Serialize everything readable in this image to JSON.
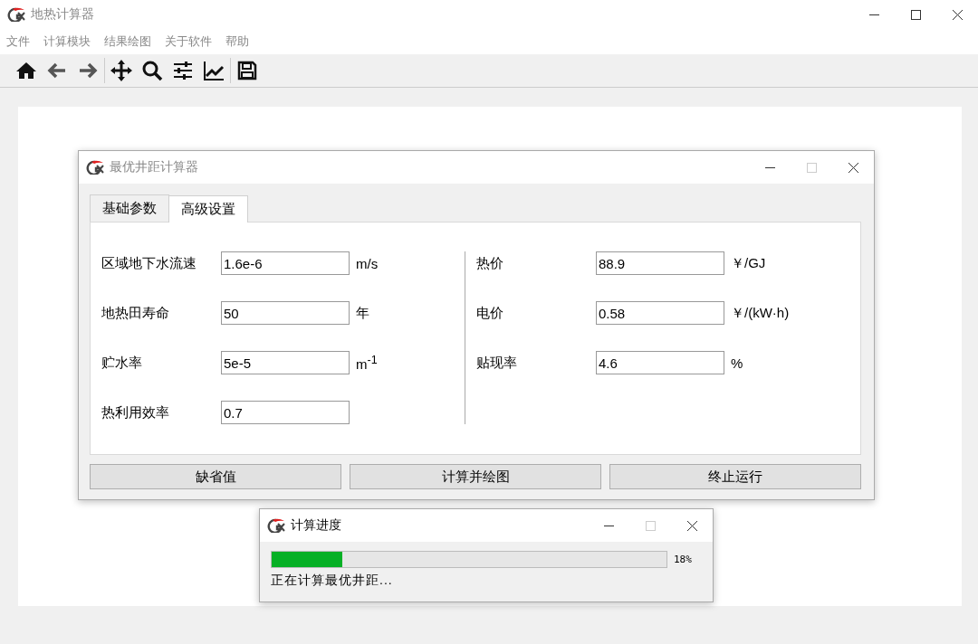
{
  "main_window": {
    "title": "地热计算器",
    "active": false,
    "maximize_disabled": false
  },
  "menu": [
    "文件",
    "计算模块",
    "结果绘图",
    "关于软件",
    "帮助"
  ],
  "dialog": {
    "title": "最优井距计算器",
    "active": false,
    "maximize_disabled": true,
    "tabs": [
      {
        "label": "基础参数",
        "selected": false
      },
      {
        "label": "高级设置",
        "selected": true
      }
    ],
    "left_fields": [
      {
        "label": "区域地下水流速",
        "value": "1.6e-6",
        "unit": "m/s"
      },
      {
        "label": "地热田寿命",
        "value": "50",
        "unit": "年"
      },
      {
        "label": "贮水率",
        "value": "5e-5",
        "unit": "m$^{-1}$"
      },
      {
        "label": "热利用效率",
        "value": "0.7"
      }
    ],
    "right_fields": [
      {
        "label": "热价",
        "value": "88.9",
        "unit": "￥/GJ"
      },
      {
        "label": "电价",
        "value": "0.58",
        "unit": "￥/(kW·h)"
      },
      {
        "label": "贴现率",
        "value": "4.6",
        "unit": "%"
      }
    ],
    "buttons": [
      "缺省值",
      "计算并绘图",
      "终止运行"
    ]
  },
  "progress_dialog": {
    "title": "计算进度",
    "active": true,
    "maximize_disabled": true,
    "level": 0.18,
    "percent": "18%",
    "status": "正在计算最优井距..."
  }
}
